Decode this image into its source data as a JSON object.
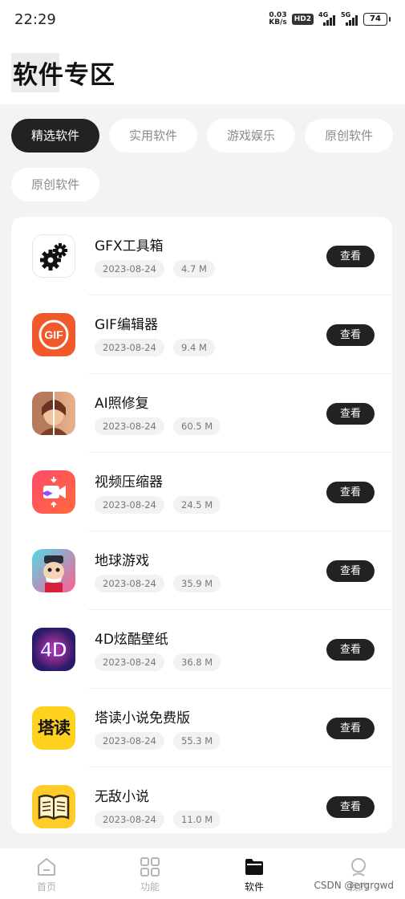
{
  "status_bar": {
    "time": "22:29",
    "speed": "0.03",
    "speed_unit": "KB/s",
    "hd": "HD2",
    "net1": "4G",
    "net2": "5G",
    "battery": "74"
  },
  "page": {
    "title": "软件专区"
  },
  "tabs": [
    "精选软件",
    "实用软件",
    "游戏娱乐",
    "原创软件",
    "原创软件"
  ],
  "apps": [
    {
      "name": "GFX工具箱",
      "date": "2023-08-24",
      "size": "4.7 M",
      "action": "查看",
      "icon": "gear-icon"
    },
    {
      "name": "GIF编辑器",
      "date": "2023-08-24",
      "size": "9.4 M",
      "action": "查看",
      "icon": "gif-icon"
    },
    {
      "name": "AI照修复",
      "date": "2023-08-24",
      "size": "60.5 M",
      "action": "查看",
      "icon": "photo-repair-icon"
    },
    {
      "name": "视频压缩器",
      "date": "2023-08-24",
      "size": "24.5 M",
      "action": "查看",
      "icon": "video-compress-icon"
    },
    {
      "name": "地球游戏",
      "date": "2023-08-24",
      "size": "35.9 M",
      "action": "查看",
      "icon": "game-character-icon"
    },
    {
      "name": "4D炫酷壁纸",
      "date": "2023-08-24",
      "size": "36.8 M",
      "action": "查看",
      "icon": "wallpaper-4d-icon"
    },
    {
      "name": "塔读小说免费版",
      "date": "2023-08-24",
      "size": "55.3 M",
      "action": "查看",
      "icon": "tadu-text-icon",
      "icon_text": "塔读"
    },
    {
      "name": "无敌小说",
      "date": "2023-08-24",
      "size": "11.0 M",
      "action": "查看",
      "icon": "book-icon"
    }
  ],
  "bottom_nav": [
    {
      "label": "首页",
      "icon": "home-icon"
    },
    {
      "label": "功能",
      "icon": "grid-icon"
    },
    {
      "label": "软件",
      "icon": "folder-icon",
      "active": true
    },
    {
      "label": "我的",
      "icon": "profile-icon"
    }
  ],
  "watermark": "CSDN @ergrgwd"
}
